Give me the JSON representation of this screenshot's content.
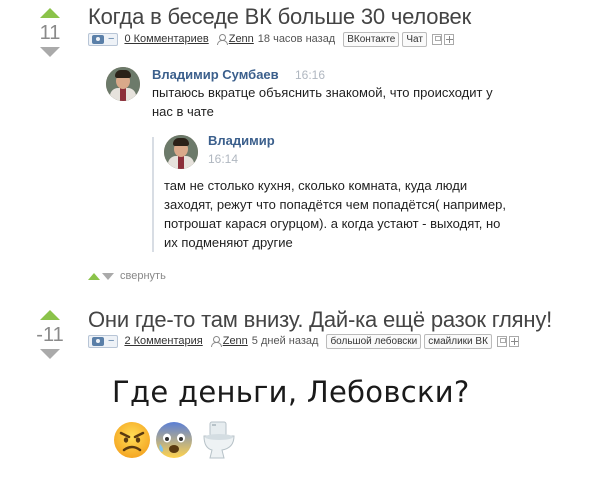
{
  "posts": [
    {
      "rating": "11",
      "title": "Когда в беседе ВК больше 30 человек",
      "comments": "0 Комментариев",
      "author": "Zenn",
      "time": "18 часов назад",
      "tags": [
        "ВКонтакте",
        "Чат"
      ]
    },
    {
      "rating": "-11",
      "title": "Они где-то там внизу. Дай-ка ещё разок гляну!",
      "comments": "2 Комментария",
      "author": "Zenn",
      "time": "5 дней назад",
      "tags": [
        "большой лебовски",
        "смайлики ВК"
      ]
    }
  ],
  "chat": {
    "msg1_name": "Владимир Сумбаев",
    "msg1_time": "16:16",
    "msg1_line1": "пытаюсь вкратце объяснить знакомой, что происходит у",
    "msg1_line2": "нас в чате",
    "msg2_name": "Владимир",
    "msg2_time": "16:14",
    "msg2_lines": [
      "там не столько кухня, сколько комната, куда люди",
      "заходят, режут что попадётся чем попадётся( например,",
      "потрошат карася огурцом). а когда устают - выходят, но",
      "их подменяют другие"
    ]
  },
  "collapse_label": "свернуть",
  "post2_image_text": "Где деньги, Лебовски?",
  "emojis": [
    "angry-face-icon",
    "fearful-face-icon",
    "toilet-icon"
  ],
  "colors": {
    "upvote": "#8bc34a",
    "downvote": "#aaaaaa",
    "vk_name": "#3b5f8c",
    "title": "#444444"
  }
}
